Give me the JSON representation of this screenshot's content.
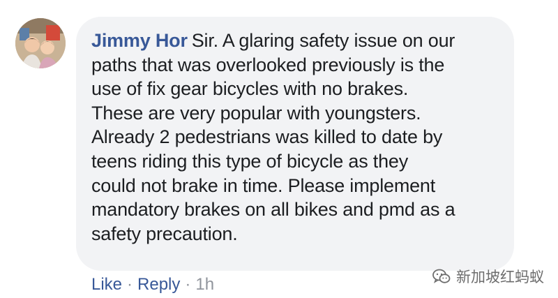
{
  "comment": {
    "author": "Jimmy Hor",
    "lines": [
      "Sir. A glaring safety issue on our",
      "paths that was overlooked previously is the",
      "use of fix gear bicycles with no brakes.",
      "These are very popular with youngsters.",
      "Already 2 pedestrians was killed to date by",
      "teens riding this type of bicycle as they",
      "could not brake in time. Please implement",
      "mandatory brakes on all bikes and pmd as a",
      "safety precaution."
    ]
  },
  "actions": {
    "like": "Like",
    "reply": "Reply",
    "time": "1h",
    "separator": "·"
  },
  "watermark": {
    "text": "新加坡红蚂蚁",
    "icon": "wechat-icon"
  },
  "avatar": {
    "icon": "user-photo"
  },
  "colors": {
    "link": "#385898",
    "bubble": "#f2f3f5",
    "text": "#1c1e21",
    "muted": "#90949c"
  }
}
